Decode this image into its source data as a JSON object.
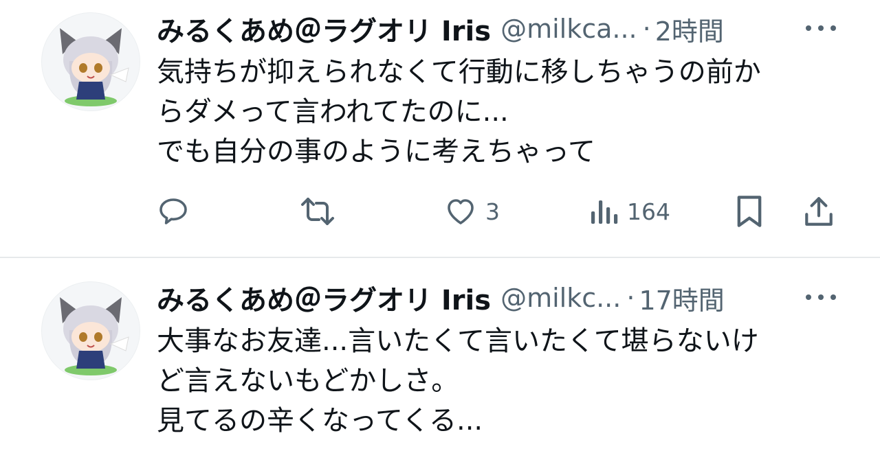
{
  "tweets": [
    {
      "author_name": "みるくあめ＠ラグオリ Iris",
      "handle": "@milkca...",
      "separator": "·",
      "time": "2時間",
      "text_lines": [
        "気持ちが抑えられなくて行動に移しちゃうの前か",
        "らダメって言われてたのに...",
        "でも自分の事のように考えちゃって"
      ],
      "actions": {
        "reply_icon": "reply-icon",
        "retweet_icon": "retweet-icon",
        "like_icon": "heart-icon",
        "like_count": "3",
        "views_icon": "views-icon",
        "views_count": "164",
        "bookmark_icon": "bookmark-icon",
        "share_icon": "share-icon"
      }
    },
    {
      "author_name": "みるくあめ＠ラグオリ Iris",
      "handle": "@milkc...",
      "separator": "·",
      "time": "17時間",
      "text_lines": [
        "大事なお友達...言いたくて言いたくて堪らないけ",
        "ど言えないもどかしさ。",
        "見てるの辛くなってくる..."
      ]
    }
  ],
  "colors": {
    "text_primary": "#0f1419",
    "text_secondary": "#536471",
    "divider": "#e6e9eb",
    "background": "#ffffff"
  }
}
